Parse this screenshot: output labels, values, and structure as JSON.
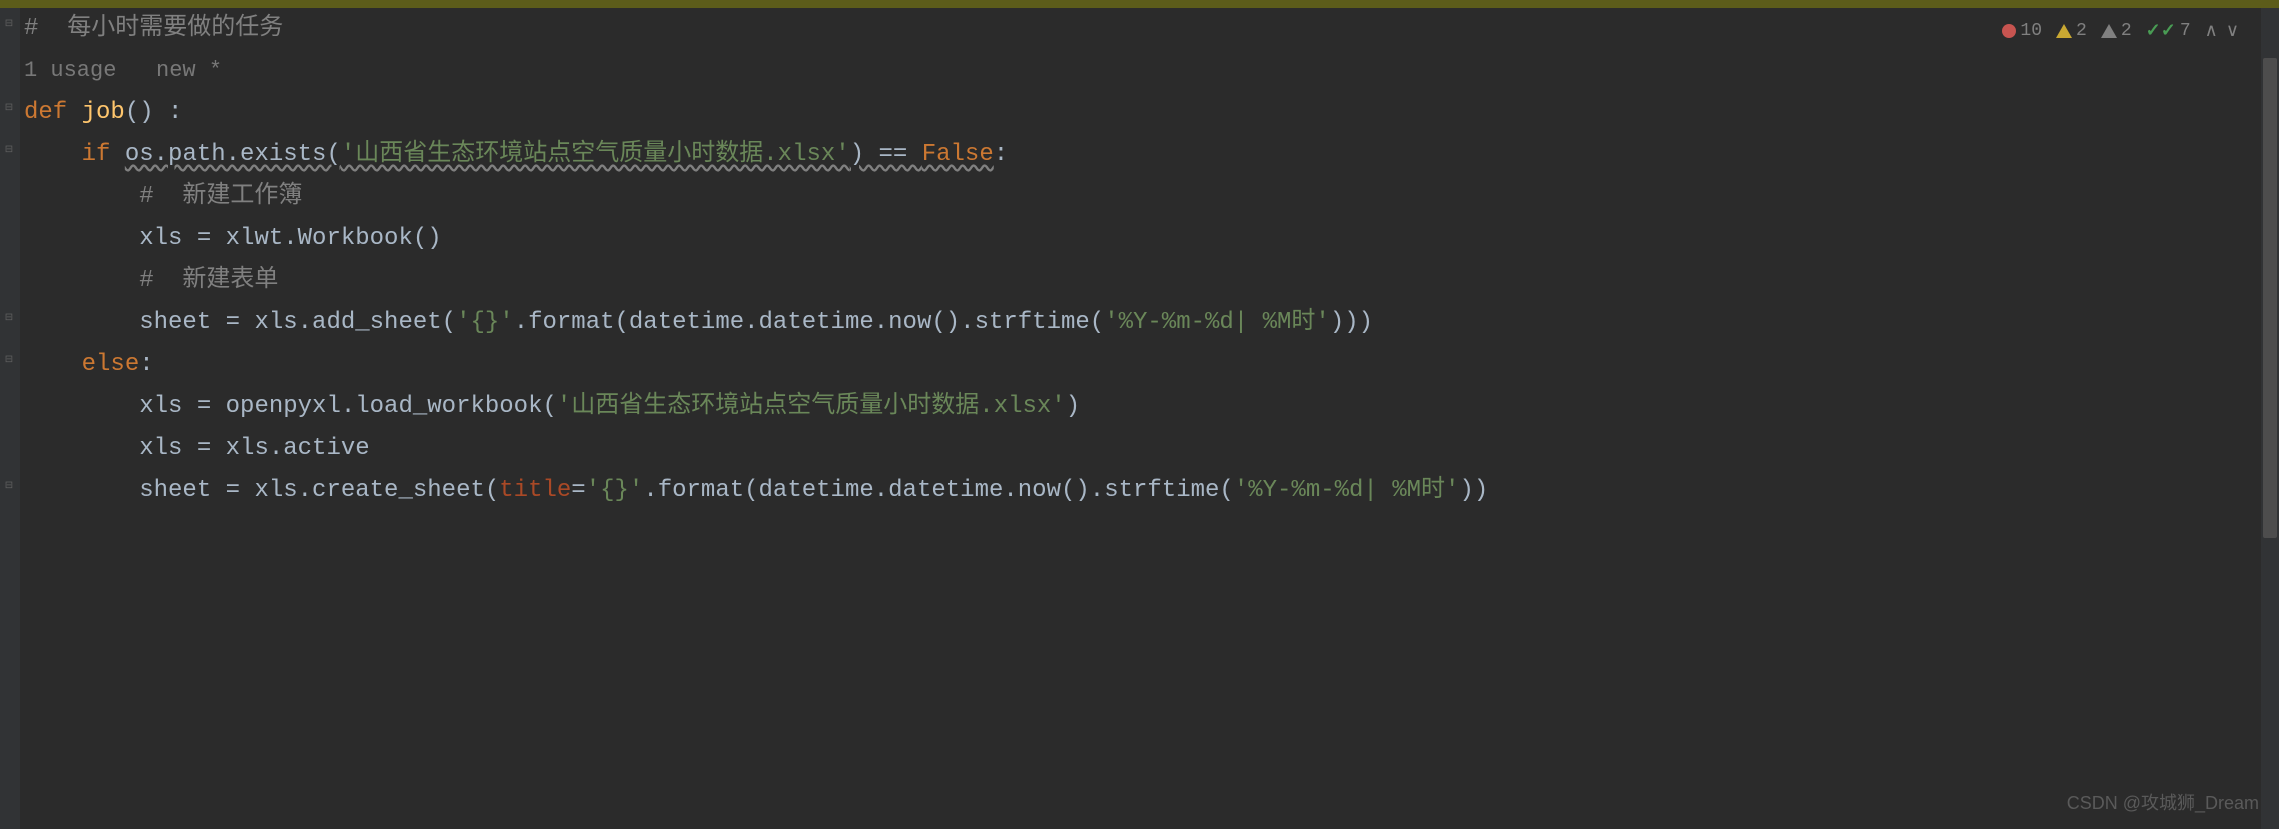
{
  "inspections": {
    "errors": "10",
    "warnings": "2",
    "weak_warnings": "2",
    "checks": "7"
  },
  "code": {
    "comment1": "#  每小时需要做的任务",
    "usage_hint": "1 usage   new *",
    "def_kw": "def ",
    "func_name": "job",
    "def_rest": "() :",
    "if_kw": "if ",
    "if_cond1": "os.path.exists(",
    "if_str1": "'山西省生态环境站点空气质量小时数据.xlsx'",
    "if_cond2": ") == ",
    "false_kw": "False",
    "colon": ":",
    "comment2": "#  新建工作簿",
    "line_xls1": "        xls = xlwt.Workbook()",
    "comment3": "#  新建表单",
    "line_sheet1a": "        sheet = xls.add_sheet(",
    "line_sheet1_str": "'{}'",
    "line_sheet1b": ".format(datetime.datetime.now().strftime(",
    "line_sheet1_str2": "'%Y-%m-%d| %M时'",
    "line_sheet1c": ")))",
    "else_kw": "else",
    "line_xls2a": "        xls = openpyxl.load_workbook(",
    "line_xls2_str": "'山西省生态环境站点空气质量小时数据.xlsx'",
    "line_xls2b": ")",
    "line_xls3": "        xls = xls.active",
    "line_sheet2a": "        sheet = xls.create_sheet(",
    "line_sheet2_param": "title",
    "line_sheet2b": "=",
    "line_sheet2_str": "'{}'",
    "line_sheet2c": ".format(datetime.datetime.now().strftime(",
    "line_sheet2_str2": "'%Y-%m-%d| %M时'",
    "line_sheet2d": "))"
  },
  "watermark": "CSDN @攻城狮_Dream"
}
